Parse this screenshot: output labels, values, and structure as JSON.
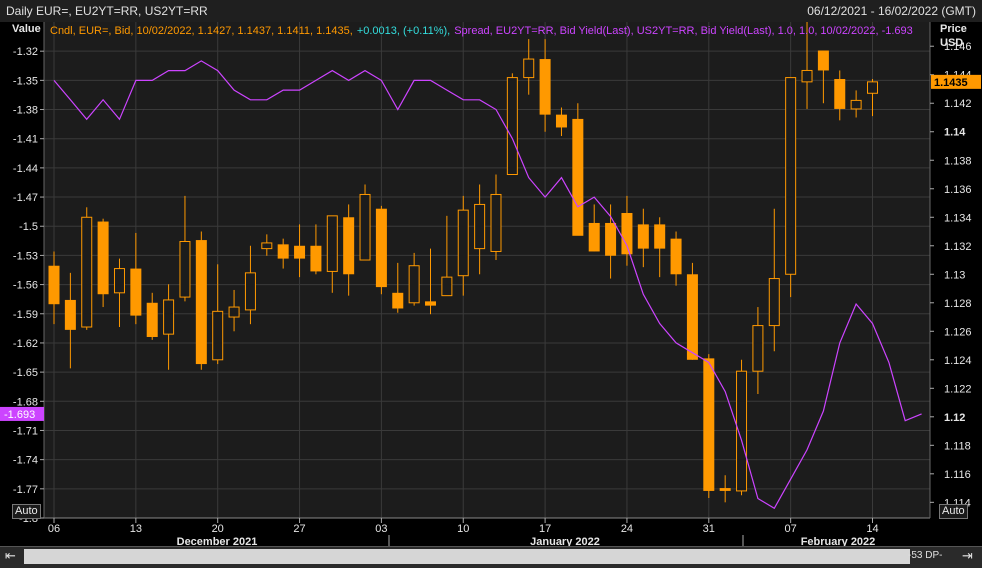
{
  "header": {
    "title": "Daily EUR=, EU2YT=RR, US2YT=RR",
    "date_range": "06/12/2021 - 16/02/2022 (GMT)"
  },
  "left_axis_title": "Value",
  "right_axis_title_1": "Price",
  "right_axis_title_2": "USD",
  "legend": {
    "candle": "Cndl, EUR=, Bid, 10/02/2022, 1.1427, 1.1437, 1.1411, 1.1435,",
    "candle_change": "+0.0013, (+0.11%),",
    "spread": "Spread, EU2YT=RR, Bid Yield(Last), US2YT=RR, Bid Yield(Last),  1.0, 1.0, 10/02/2022, -1.693"
  },
  "last_price_label": "1.1435",
  "last_spread_label": "-1.693",
  "auto_left": "Auto",
  "auto_right": "Auto",
  "datapoints_label": "-53 DP-",
  "colors": {
    "candle": "#ff9900",
    "spread": "#cc44ff",
    "change": "#33dddd",
    "background": "#1c1c1c"
  },
  "chart_data": {
    "type": "candlestick",
    "x_tick_labels": [
      "06",
      "13",
      "20",
      "27",
      "03",
      "10",
      "17",
      "24",
      "31",
      "07",
      "14"
    ],
    "month_labels": [
      "December 2021",
      "January 2022",
      "February 2022"
    ],
    "left_axis": {
      "label": "Value",
      "ticks": [
        -1.32,
        -1.35,
        -1.38,
        -1.41,
        -1.44,
        -1.47,
        -1.5,
        -1.53,
        -1.56,
        -1.59,
        -1.62,
        -1.65,
        -1.68,
        -1.71,
        -1.74,
        -1.77,
        -1.8
      ],
      "range": [
        -1.8,
        -1.29
      ]
    },
    "right_axis": {
      "label": "Price USD",
      "ticks": [
        1.146,
        1.144,
        1.142,
        1.14,
        1.138,
        1.136,
        1.134,
        1.132,
        1.13,
        1.128,
        1.126,
        1.124,
        1.122,
        1.12,
        1.118,
        1.116,
        1.114
      ],
      "bold_ticks": [
        1.14,
        1.12
      ],
      "range": [
        1.1129,
        1.1477
      ]
    },
    "candles": [
      {
        "o": 1.1306,
        "h": 1.1316,
        "l": 1.1265,
        "c": 1.1279
      },
      {
        "o": 1.1282,
        "h": 1.1301,
        "l": 1.1234,
        "c": 1.1261
      },
      {
        "o": 1.1263,
        "h": 1.1347,
        "l": 1.1261,
        "c": 1.134
      },
      {
        "o": 1.1337,
        "h": 1.1339,
        "l": 1.1277,
        "c": 1.1286
      },
      {
        "o": 1.1287,
        "h": 1.1311,
        "l": 1.1263,
        "c": 1.1304
      },
      {
        "o": 1.1304,
        "h": 1.1329,
        "l": 1.1265,
        "c": 1.1271
      },
      {
        "o": 1.128,
        "h": 1.1287,
        "l": 1.1254,
        "c": 1.1256
      },
      {
        "o": 1.1258,
        "h": 1.1293,
        "l": 1.1233,
        "c": 1.1282
      },
      {
        "o": 1.1284,
        "h": 1.1355,
        "l": 1.1281,
        "c": 1.1323
      },
      {
        "o": 1.1324,
        "h": 1.133,
        "l": 1.1233,
        "c": 1.1237
      },
      {
        "o": 1.124,
        "h": 1.1307,
        "l": 1.1237,
        "c": 1.1274
      },
      {
        "o": 1.127,
        "h": 1.1289,
        "l": 1.126,
        "c": 1.1277
      },
      {
        "o": 1.1275,
        "h": 1.132,
        "l": 1.1265,
        "c": 1.1301
      },
      {
        "o": 1.1318,
        "h": 1.1328,
        "l": 1.1313,
        "c": 1.1322
      },
      {
        "o": 1.1321,
        "h": 1.1325,
        "l": 1.1304,
        "c": 1.1311
      },
      {
        "o": 1.132,
        "h": 1.1335,
        "l": 1.1298,
        "c": 1.1311
      },
      {
        "o": 1.132,
        "h": 1.1335,
        "l": 1.13,
        "c": 1.1302
      },
      {
        "o": 1.1302,
        "h": 1.1335,
        "l": 1.1287,
        "c": 1.1341
      },
      {
        "o": 1.134,
        "h": 1.1349,
        "l": 1.1285,
        "c": 1.13
      },
      {
        "o": 1.131,
        "h": 1.1363,
        "l": 1.131,
        "c": 1.1356
      },
      {
        "o": 1.1346,
        "h": 1.1348,
        "l": 1.1286,
        "c": 1.1291
      },
      {
        "o": 1.1287,
        "h": 1.1308,
        "l": 1.1273,
        "c": 1.1276
      },
      {
        "o": 1.128,
        "h": 1.1315,
        "l": 1.1278,
        "c": 1.1306
      },
      {
        "o": 1.1281,
        "h": 1.1318,
        "l": 1.1272,
        "c": 1.1278
      },
      {
        "o": 1.1285,
        "h": 1.1341,
        "l": 1.1285,
        "c": 1.1298
      },
      {
        "o": 1.1299,
        "h": 1.1355,
        "l": 1.1285,
        "c": 1.1345
      },
      {
        "o": 1.1318,
        "h": 1.1363,
        "l": 1.13,
        "c": 1.1349
      },
      {
        "o": 1.1316,
        "h": 1.137,
        "l": 1.131,
        "c": 1.1356
      },
      {
        "o": 1.137,
        "h": 1.1441,
        "l": 1.137,
        "c": 1.1438
      },
      {
        "o": 1.1438,
        "h": 1.1465,
        "l": 1.1426,
        "c": 1.1451
      },
      {
        "o": 1.1451,
        "h": 1.1465,
        "l": 1.14,
        "c": 1.1412
      },
      {
        "o": 1.1412,
        "h": 1.1417,
        "l": 1.1397,
        "c": 1.1403
      },
      {
        "o": 1.1409,
        "h": 1.142,
        "l": 1.1355,
        "c": 1.1327
      },
      {
        "o": 1.1336,
        "h": 1.1349,
        "l": 1.1316,
        "c": 1.1316
      },
      {
        "o": 1.1336,
        "h": 1.1349,
        "l": 1.1297,
        "c": 1.1313
      },
      {
        "o": 1.1343,
        "h": 1.1355,
        "l": 1.1306,
        "c": 1.1314
      },
      {
        "o": 1.1335,
        "h": 1.1346,
        "l": 1.1305,
        "c": 1.1318
      },
      {
        "o": 1.1335,
        "h": 1.134,
        "l": 1.1298,
        "c": 1.1318
      },
      {
        "o": 1.1325,
        "h": 1.133,
        "l": 1.1292,
        "c": 1.13
      },
      {
        "o": 1.13,
        "h": 1.1308,
        "l": 1.124,
        "c": 1.124
      },
      {
        "o": 1.1241,
        "h": 1.1244,
        "l": 1.1143,
        "c": 1.1148
      },
      {
        "o": 1.115,
        "h": 1.1159,
        "l": 1.114,
        "c": 1.1148
      },
      {
        "o": 1.1148,
        "h": 1.124,
        "l": 1.1145,
        "c": 1.1232
      },
      {
        "o": 1.1232,
        "h": 1.1277,
        "l": 1.1216,
        "c": 1.1264
      },
      {
        "o": 1.1264,
        "h": 1.1346,
        "l": 1.1246,
        "c": 1.1297
      },
      {
        "o": 1.13,
        "h": 1.1365,
        "l": 1.1284,
        "c": 1.1438
      },
      {
        "o": 1.1435,
        "h": 1.1477,
        "l": 1.1416,
        "c": 1.1443
      },
      {
        "o": 1.1457,
        "h": 1.1457,
        "l": 1.142,
        "c": 1.1443
      },
      {
        "o": 1.1437,
        "h": 1.1443,
        "l": 1.1408,
        "c": 1.1416
      },
      {
        "o": 1.1416,
        "h": 1.1429,
        "l": 1.141,
        "c": 1.1422
      },
      {
        "o": 1.1427,
        "h": 1.1437,
        "l": 1.1411,
        "c": 1.1435
      }
    ],
    "spread": {
      "name": "Spread, EU2YT=RR, Bid Yield(Last), US2YT=RR, Bid Yield(Last)",
      "values": [
        -1.35,
        -1.37,
        -1.39,
        -1.37,
        -1.39,
        -1.35,
        -1.35,
        -1.34,
        -1.34,
        -1.33,
        -1.34,
        -1.36,
        -1.37,
        -1.37,
        -1.36,
        -1.36,
        -1.35,
        -1.34,
        -1.35,
        -1.34,
        -1.35,
        -1.38,
        -1.35,
        -1.35,
        -1.36,
        -1.37,
        -1.37,
        -1.38,
        -1.41,
        -1.45,
        -1.47,
        -1.45,
        -1.48,
        -1.47,
        -1.49,
        -1.52,
        -1.57,
        -1.6,
        -1.62,
        -1.63,
        -1.64,
        -1.67,
        -1.72,
        -1.78,
        -1.79,
        -1.76,
        -1.73,
        -1.69,
        -1.62,
        -1.58,
        -1.6,
        -1.64,
        -1.7,
        -1.693
      ]
    }
  }
}
